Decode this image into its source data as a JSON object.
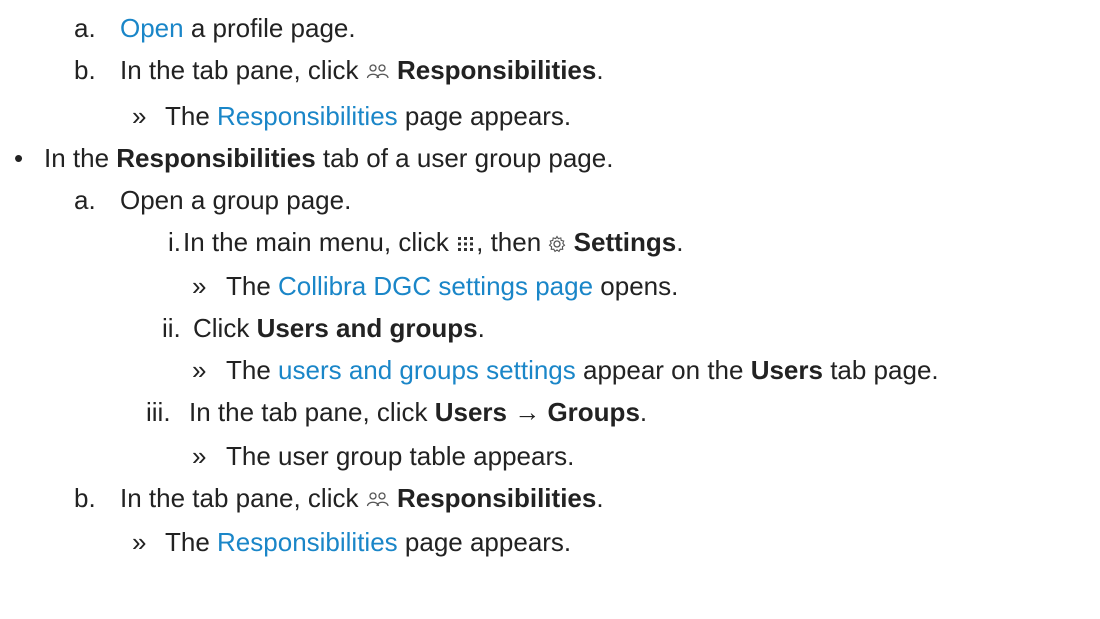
{
  "doc": {
    "step_a1": {
      "marker": "a.",
      "link": "Open",
      "rest": " a profile page."
    },
    "step_b1": {
      "marker": "b.",
      "pre": "In the tab pane, click ",
      "icon": "people-icon",
      "bold": "Responsibilities",
      "post": "."
    },
    "result_b1": {
      "marker": "»",
      "pre": "The ",
      "link": "Responsibilities",
      "post": " page appears."
    },
    "bullet_group": {
      "marker": "•",
      "pre": "In the ",
      "bold": "Responsibilities",
      "post": " tab of a user group page."
    },
    "step_a2": {
      "marker": "a.",
      "text": "Open a group page."
    },
    "step_i": {
      "marker": "i.",
      "pre": "In the main menu, click ",
      "icon1": "grid-menu-icon",
      "mid": ", then ",
      "icon2": "gear-icon",
      "bold": "Settings",
      "post": "."
    },
    "result_i": {
      "marker": "»",
      "pre": "The ",
      "link": "Collibra DGC settings page",
      "post": " opens."
    },
    "step_ii": {
      "marker": "ii.",
      "pre": "Click ",
      "bold": "Users and groups",
      "post": "."
    },
    "result_ii": {
      "marker": "»",
      "pre": "The ",
      "link": "users and groups settings",
      "mid": " appear on the ",
      "bold": "Users",
      "post": " tab page."
    },
    "step_iii": {
      "marker": "iii.",
      "pre": "In the tab pane, click ",
      "bold1": "Users",
      "arrow": " → ",
      "bold2": "Groups",
      "post": "."
    },
    "result_iii": {
      "marker": "»",
      "text": "The user group table appears."
    },
    "step_b2": {
      "marker": "b.",
      "pre": "In the tab pane, click ",
      "icon": "people-icon",
      "bold": "Responsibilities",
      "post": "."
    },
    "result_b2": {
      "marker": "»",
      "pre": "The ",
      "link": "Responsibilities",
      "post": " page appears."
    }
  }
}
